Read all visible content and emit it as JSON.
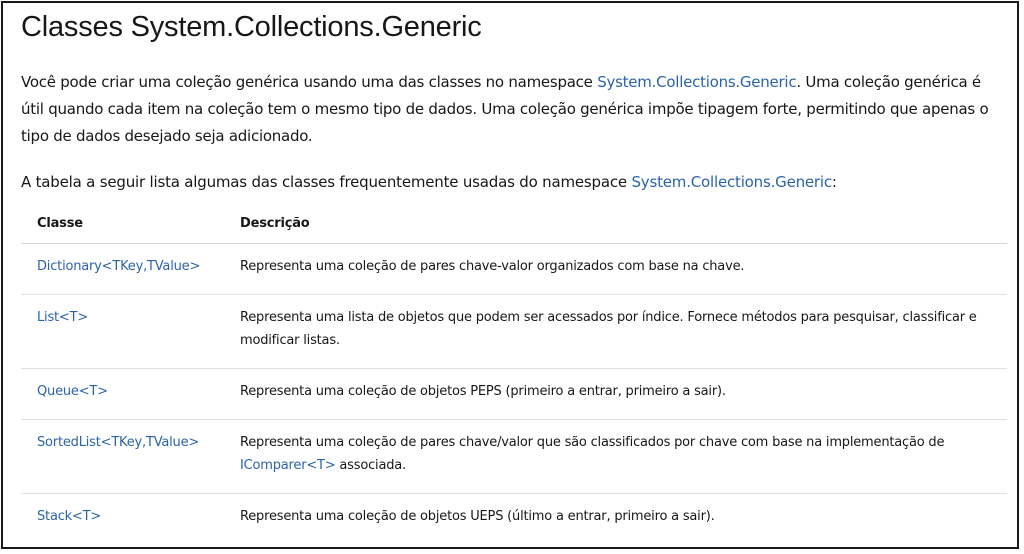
{
  "title": "Classes System.Collections.Generic",
  "intro": {
    "before_link": "Você pode criar uma coleção genérica usando uma das classes no namespace ",
    "link": "System.Collections.Generic",
    "after_link": ". Uma coleção genérica é útil quando cada item na coleção tem o mesmo tipo de dados. Uma coleção genérica impõe tipagem forte, permitindo que apenas o tipo de dados desejado seja adicionado."
  },
  "table_intro": {
    "before_link": "A tabela a seguir lista algumas das classes frequentemente usadas do namespace ",
    "link": "System.Collections.Generic",
    "after_link": ":"
  },
  "table": {
    "headers": [
      "Classe",
      "Descrição"
    ],
    "rows": [
      {
        "class": "Dictionary<TKey,TValue>",
        "description": "Representa uma coleção de pares chave-valor organizados com base na chave."
      },
      {
        "class": "List<T>",
        "description": "Representa uma lista de objetos que podem ser acessados por índice. Fornece métodos para pesquisar, classificar e modificar listas."
      },
      {
        "class": "Queue<T>",
        "description": "Representa uma coleção de objetos PEPS (primeiro a entrar, primeiro a sair)."
      },
      {
        "class": "SortedList<TKey,TValue>",
        "description_before_link": "Representa uma coleção de pares chave/valor que são classificados por chave com base na implementação de ",
        "description_link": "IComparer<T>",
        "description_after_link": " associada."
      },
      {
        "class": "Stack<T>",
        "description": "Representa uma coleção de objetos UEPS (último a entrar, primeiro a sair)."
      }
    ]
  },
  "colors": {
    "link": "#2a64a8",
    "text": "#171717",
    "border": "#1a1a1a"
  }
}
